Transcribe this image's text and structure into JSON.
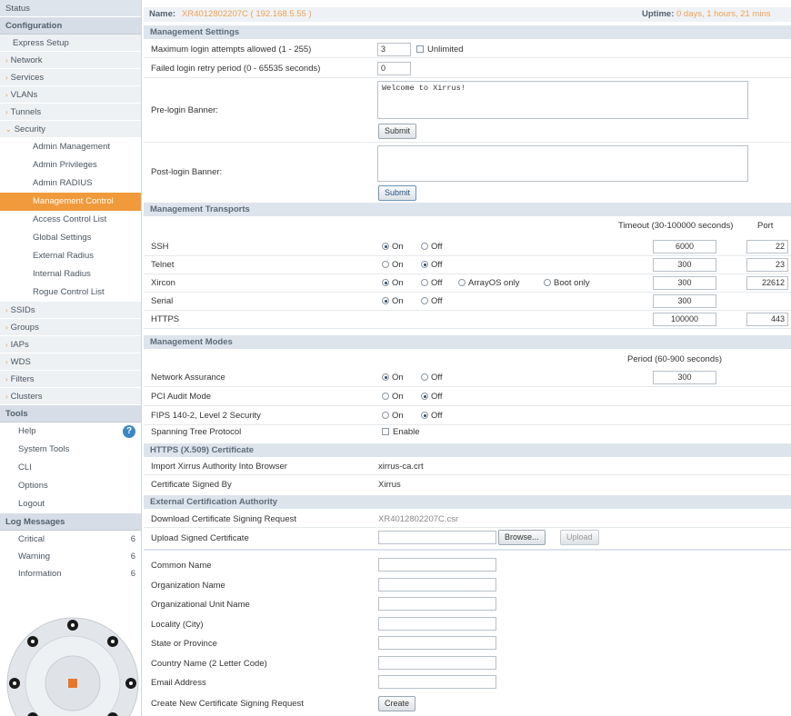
{
  "sidebar": {
    "status": "Status",
    "configuration": "Configuration",
    "config_items": [
      {
        "label": "Express Setup",
        "arrow": ""
      },
      {
        "label": "Network",
        "arrow": "›"
      },
      {
        "label": "Services",
        "arrow": "›"
      },
      {
        "label": "VLANs",
        "arrow": "›"
      },
      {
        "label": "Tunnels",
        "arrow": "›"
      },
      {
        "label": "Security",
        "arrow": "⌄"
      }
    ],
    "security_items": [
      "Admin Management",
      "Admin Privileges",
      "Admin RADIUS",
      "Management Control",
      "Access Control List",
      "Global Settings",
      "External Radius",
      "Internal Radius",
      "Rogue Control List"
    ],
    "active_security_item": "Management Control",
    "more_items": [
      {
        "label": "SSIDs",
        "arrow": "›"
      },
      {
        "label": "Groups",
        "arrow": "›"
      },
      {
        "label": "IAPs",
        "arrow": "›"
      },
      {
        "label": "WDS",
        "arrow": "›"
      },
      {
        "label": "Filters",
        "arrow": "›"
      },
      {
        "label": "Clusters",
        "arrow": "›"
      }
    ],
    "tools": "Tools",
    "tool_items": [
      "Help",
      "System Tools",
      "CLI",
      "Options",
      "Logout"
    ],
    "log_messages": "Log Messages",
    "log_items": [
      {
        "label": "Critical",
        "count": "6"
      },
      {
        "label": "Warning",
        "count": "6"
      },
      {
        "label": "Information",
        "count": "6"
      }
    ]
  },
  "status_bar": {
    "name_label": "Name:",
    "name_value": "XR4012802207C   ( 192.168.5.55 )",
    "uptime_label": "Uptime:",
    "uptime_value": "0 days, 1 hours, 21 mins"
  },
  "management_settings": {
    "header": "Management Settings",
    "max_login_label": "Maximum login attempts allowed (1 - 255)",
    "max_login_value": "3",
    "unlimited_label": "Unlimited",
    "retry_label": "Failed login retry period (0 - 65535 seconds)",
    "retry_value": "0",
    "prelogin_label": "Pre-login Banner:",
    "prelogin_value": "Welcome to Xirrus!",
    "submit1": "Submit",
    "postlogin_label": "Post-login Banner:",
    "postlogin_value": "",
    "submit2": "Submit"
  },
  "management_transports": {
    "header": "Management Transports",
    "timeout_header": "Timeout (30-100000 seconds)",
    "port_header": "Port",
    "rows": [
      {
        "label": "SSH",
        "on": true,
        "timeout": "6000",
        "port": "22"
      },
      {
        "label": "Telnet",
        "on": false,
        "timeout": "300",
        "port": "23"
      },
      {
        "label": "Xircon",
        "on": true,
        "timeout": "300",
        "port": "22612",
        "extra1": "ArrayOS only",
        "extra2": "Boot only"
      },
      {
        "label": "Serial",
        "on": true,
        "timeout": "300",
        "port": ""
      },
      {
        "label": "HTTPS",
        "on": null,
        "timeout": "100000",
        "port": "443"
      }
    ],
    "on_label": "On",
    "off_label": "Off"
  },
  "management_modes": {
    "header": "Management Modes",
    "period_header": "Period (60-900 seconds)",
    "rows": [
      {
        "label": "Network Assurance",
        "on": true,
        "period": "300"
      },
      {
        "label": "PCI Audit Mode",
        "on": false
      },
      {
        "label": "FIPS 140-2, Level 2 Security",
        "on": false
      }
    ],
    "stp_label": "Spanning Tree Protocol",
    "stp_enable": "Enable"
  },
  "https_cert": {
    "header": "HTTPS (X.509) Certificate",
    "import_label": "Import Xirrus Authority Into Browser",
    "import_value": "xirrus-ca.crt",
    "signed_label": "Certificate Signed By",
    "signed_value": "Xirrus"
  },
  "external_ca": {
    "header": "External Certification Authority",
    "download_label": "Download Certificate Signing Request",
    "download_value": "XR4012802207C.csr",
    "upload_label": "Upload Signed Certificate",
    "browse": "Browse...",
    "upload": "Upload",
    "fields": [
      "Common Name",
      "Organization Name",
      "Organizational Unit Name",
      "Locality (City)",
      "State or Province",
      "Country Name (2 Letter Code)",
      "Email Address"
    ],
    "create_label": "Create New Certificate Signing Request",
    "create_button": "Create"
  },
  "colors": {
    "accent_orange": "#f09a3c",
    "section_bg": "#dde4ec",
    "sidebar_header": "#d6dde6"
  }
}
